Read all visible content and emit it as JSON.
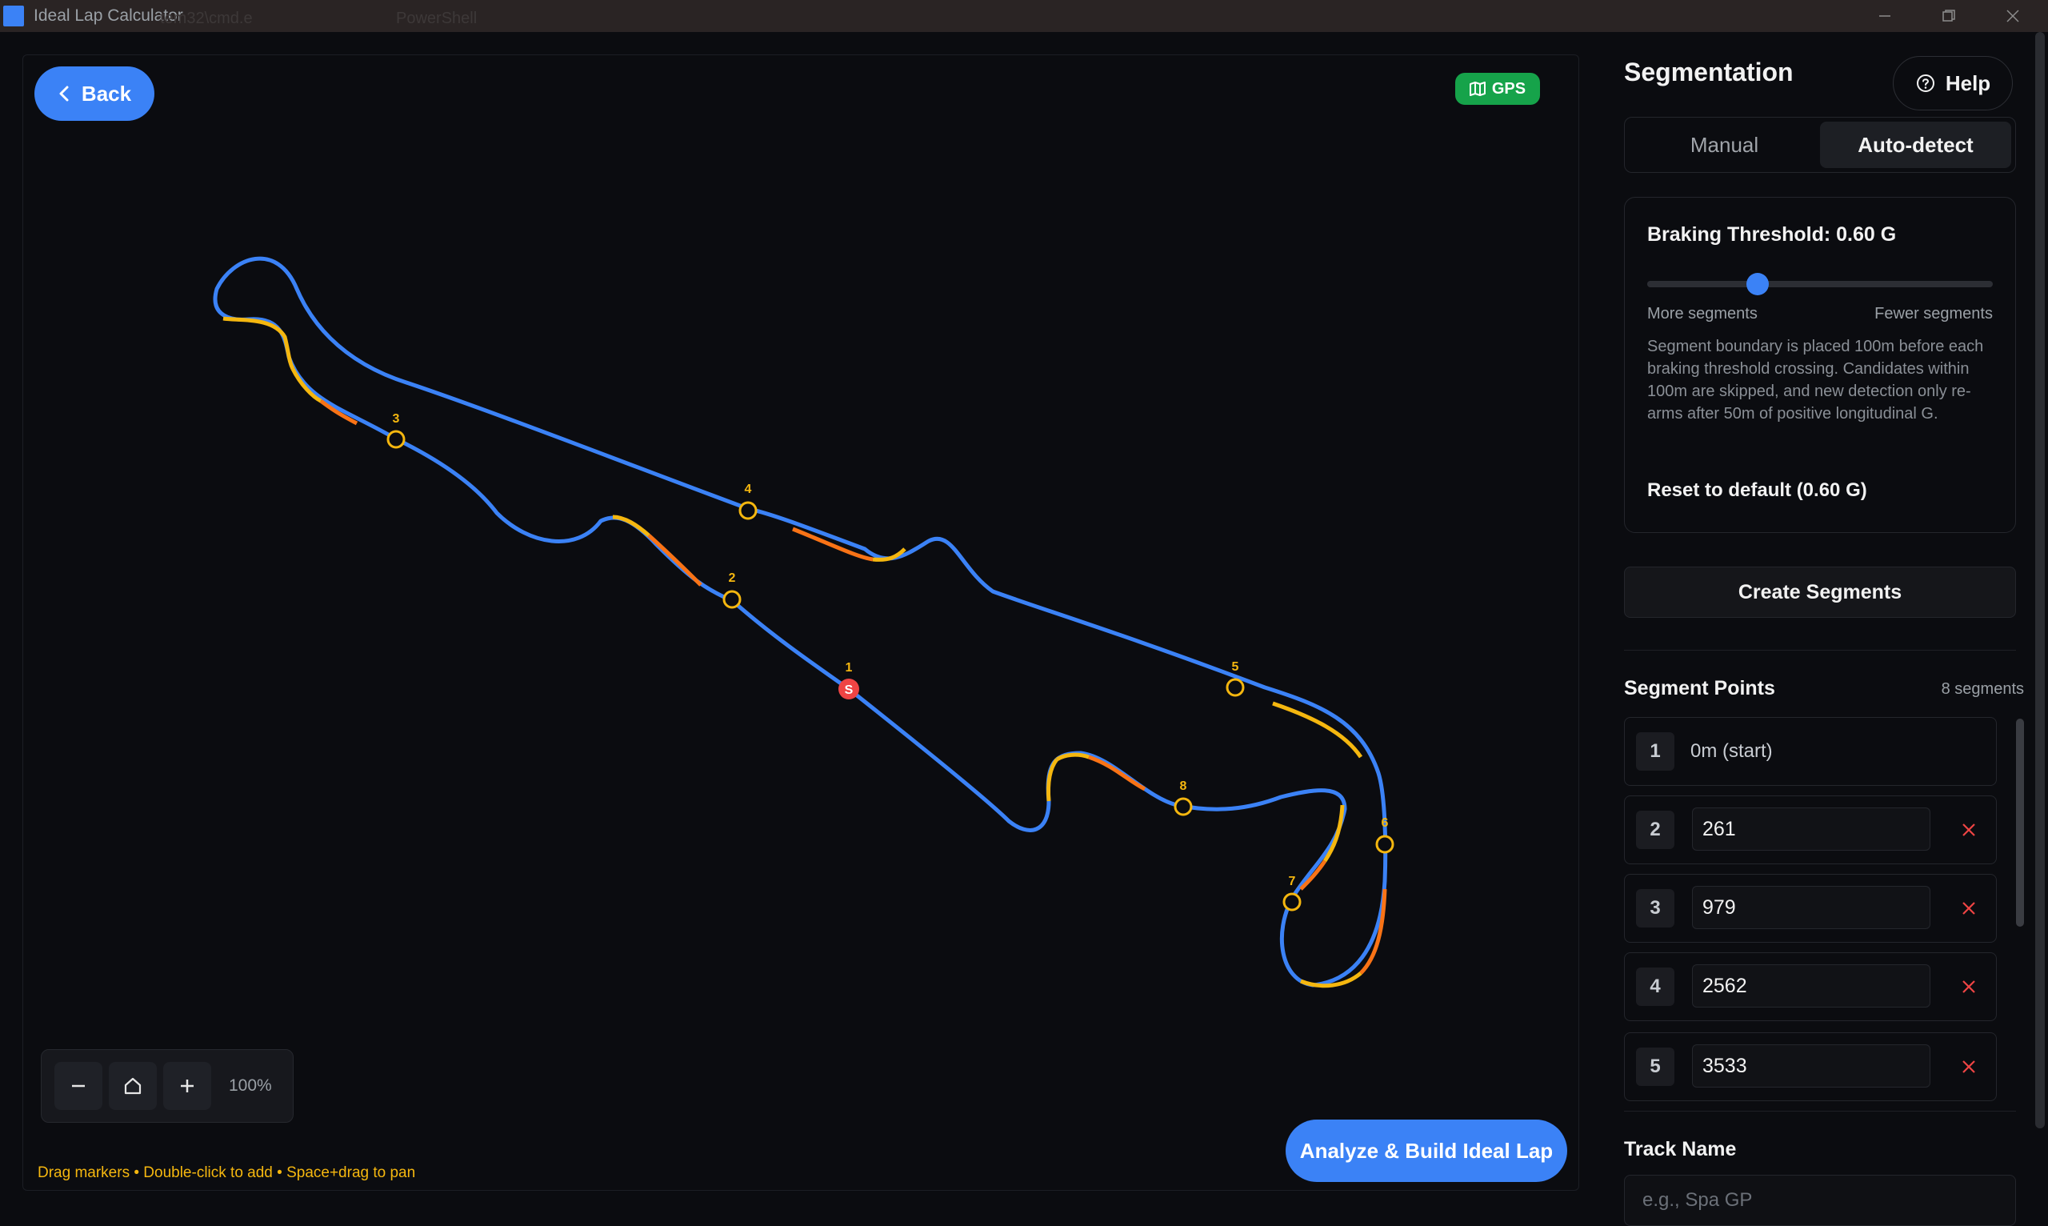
{
  "window": {
    "title": "Ideal Lap Calculator",
    "ghost_tab_1": "tem32\\cmd.e",
    "ghost_tab_2": "PowerShell"
  },
  "map": {
    "back_label": "Back",
    "gps_label": "GPS",
    "zoom_level": "100%",
    "hint": "Drag markers • Double-click to add • Space+drag to pan",
    "analyze_label": "Analyze & Build Ideal Lap",
    "start_marker": "S",
    "markers": [
      "1",
      "2",
      "3",
      "4",
      "5",
      "6",
      "7",
      "8"
    ]
  },
  "sidebar": {
    "title": "Segmentation",
    "help_label": "Help",
    "tabs": [
      {
        "label": "Manual",
        "active": false
      },
      {
        "label": "Auto-detect",
        "active": true
      }
    ],
    "threshold": {
      "label": "Braking Threshold: 0.60 G",
      "slider_value_fraction": 0.32,
      "min_label": "More segments",
      "max_label": "Fewer segments",
      "description": "Segment boundary is placed 100m before each braking threshold crossing. Candidates within 100m are skipped, and new detection only re-arms after 50m of positive longitudinal G.",
      "reset_label": "Reset to default (0.60 G)"
    },
    "create_label": "Create Segments",
    "segment_points": {
      "title": "Segment Points",
      "count": "8 segments",
      "rows": [
        {
          "num": "1",
          "value": "0m (start)"
        },
        {
          "num": "2",
          "value": "261"
        },
        {
          "num": "3",
          "value": "979"
        },
        {
          "num": "4",
          "value": "2562"
        },
        {
          "num": "5",
          "value": "3533"
        }
      ]
    },
    "track_name": {
      "label": "Track Name",
      "placeholder": "e.g., Spa GP"
    }
  },
  "colors": {
    "accent": "#3b82f6",
    "gps": "#16a34a",
    "marker": "#f5b70f",
    "start": "#ef4444",
    "brake_orange": "#f97316",
    "track_blue": "#3b82f6"
  }
}
